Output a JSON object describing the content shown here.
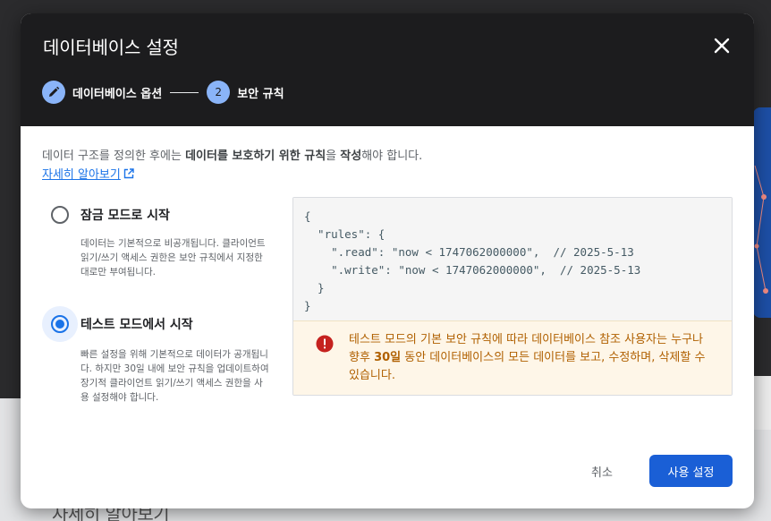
{
  "background": {
    "peek_text": "자세히 알아보기"
  },
  "dialog": {
    "title": "데이터베이스 설정",
    "close_icon": "close-icon",
    "steps": [
      {
        "number": "",
        "icon": "pencil-icon",
        "label": "데이터베이스 옵션"
      },
      {
        "number": "2",
        "label": "보안 규칙"
      }
    ],
    "intro": {
      "part1": "데이터 구조를 정의한 후에는 ",
      "bold1": "데이터를 보호하기 위한 규칙",
      "part2": "을 ",
      "bold2": "작성",
      "part3": "해야 합니다."
    },
    "learn_more": "자세히 알아보기",
    "options": [
      {
        "label": "잠금 모드로 시작",
        "description": "데이터는 기본적으로 비공개됩니다. 클라이언트 읽기/쓰기 액세스 권한은 보안 규칙에서 지정한 대로만 부여됩니다.",
        "selected": false
      },
      {
        "label": "테스트 모드에서 시작",
        "description": "빠른 설정을 위해 기본적으로 데이터가 공개됩니다. 하지만 30일 내에 보안 규칙을 업데이트하여 장기적 클라이언트 읽기/쓰기 액세스 권한을 사용 설정해야 합니다.",
        "selected": true
      }
    ],
    "code": "{\n  \"rules\": {\n    \".read\": \"now < 1747062000000\",  // 2025-5-13\n    \".write\": \"now < 1747062000000\",  // 2025-5-13\n  }\n}",
    "warning": {
      "icon": "error-icon",
      "text_before": "테스트 모드의 기본 보안 규칙에 따라 데이터베이스 참조 사용자는 누구나 향후 ",
      "bold": "30일",
      "text_after": " 동안 데이터베이스의 모든 데이터를 보고, 수정하며, 삭제할 수 있습니다."
    },
    "cancel_label": "취소",
    "confirm_label": "사용 설정"
  },
  "colors": {
    "accent": "#1a73e8",
    "header_bg": "#1c1c1e",
    "warning_bg": "#fef6e8",
    "warning_text": "#b06000",
    "step_circle": "#8ab4f8"
  }
}
